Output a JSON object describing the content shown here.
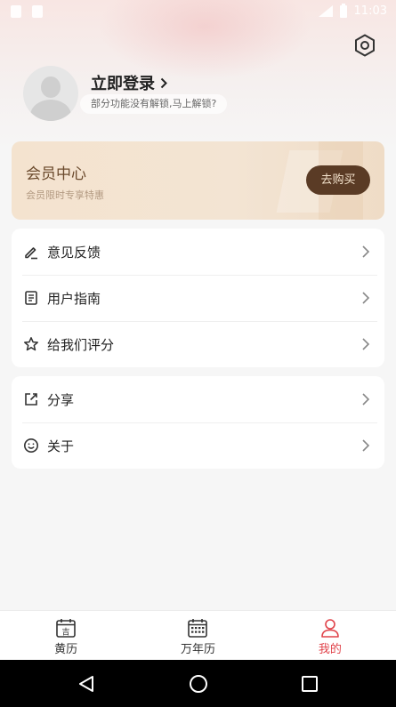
{
  "status_bar": {
    "time": "11:03"
  },
  "profile": {
    "login_label": "立即登录",
    "login_hint": "部分功能没有解锁,马上解锁?"
  },
  "member": {
    "title": "会员中心",
    "subtitle": "会员限时专享特惠",
    "buy_label": "去购买",
    "colors": {
      "button": "#5a3b25",
      "card": "#f4e3cf"
    }
  },
  "menu_group1": [
    {
      "label": "意见反馈",
      "icon": "edit-icon"
    },
    {
      "label": "用户指南",
      "icon": "guide-book-icon"
    },
    {
      "label": "给我们评分",
      "icon": "star-icon"
    }
  ],
  "menu_group2": [
    {
      "label": "分享",
      "icon": "share-icon"
    },
    {
      "label": "关于",
      "icon": "smile-icon"
    }
  ],
  "bottom_nav": {
    "items": [
      {
        "label": "黄历",
        "icon": "almanac-calendar-icon",
        "icon_text": "吉"
      },
      {
        "label": "万年历",
        "icon": "calendar-grid-icon"
      },
      {
        "label": "我的",
        "icon": "user-icon",
        "active": true
      }
    ],
    "active_color": "#e0434a"
  }
}
